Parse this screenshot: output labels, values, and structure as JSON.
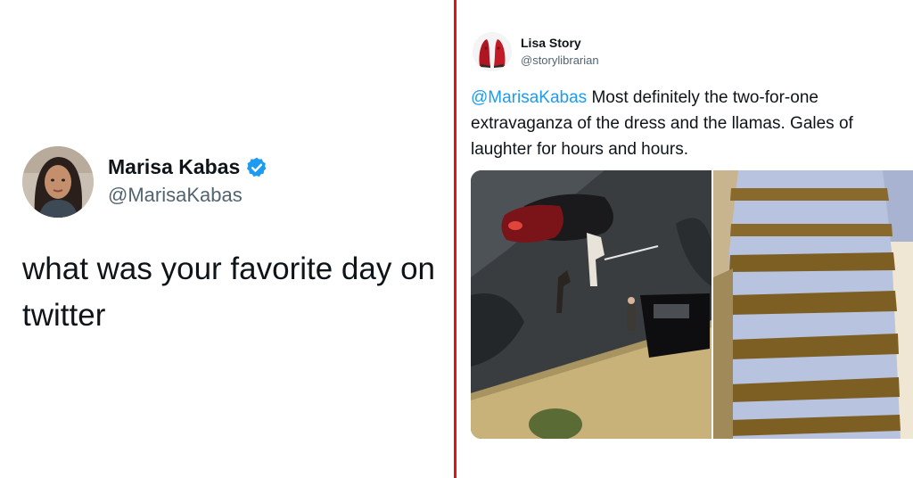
{
  "left_tweet": {
    "display_name": "Marisa Kabas",
    "handle": "@MarisaKabas",
    "text": "what was your favorite day on twitter",
    "verified": true,
    "verified_color": "#1d9bf0"
  },
  "right_tweet": {
    "display_name": "Lisa Story",
    "handle": "@storylibrarian",
    "mention": "@MarisaKabas",
    "text": " Most definitely the two-for-one extravaganza of the dress and the llamas. Gales of laughter for hours and hours.",
    "mention_color": "#1d9bf0"
  },
  "colors": {
    "divider": "#e01515",
    "text": "#0f1419",
    "secondary_text": "#536471"
  },
  "icons": [
    "verified-badge-icon"
  ]
}
